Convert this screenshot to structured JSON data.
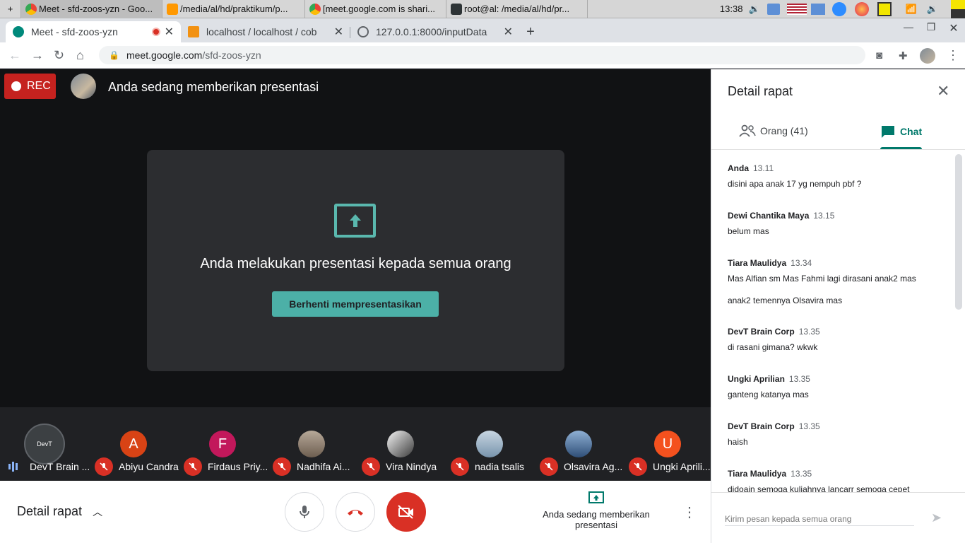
{
  "taskbar": {
    "items": [
      {
        "label": "+",
        "icon": "plus-icon"
      },
      {
        "label": "Meet - sfd-zoos-yzn - Goo...",
        "icon": "chrome-icon"
      },
      {
        "label": "/media/al/hd/praktikum/p...",
        "icon": "sublime-icon"
      },
      {
        "label": "[meet.google.com is shari...",
        "icon": "chrome-icon"
      },
      {
        "label": "root@al: /media/al/hd/pr...",
        "icon": "terminal-icon"
      }
    ],
    "clock": "13:38"
  },
  "browser": {
    "tabs": [
      {
        "title": "Meet - sfd-zoos-yzn",
        "active": true
      },
      {
        "title": "localhost / localhost / cob",
        "active": false
      },
      {
        "title": "127.0.0.1:8000/inputData",
        "active": false
      }
    ],
    "url_host": "meet.google.com",
    "url_path": "/sfd-zoos-yzn"
  },
  "meet": {
    "rec_label": "REC",
    "presenting_label": "Anda sedang memberikan presentasi",
    "card_text": "Anda melakukan presentasi kepada semua orang",
    "stop_button": "Berhenti mempresentasikan",
    "participants": [
      {
        "name": "DevT Brain ...",
        "initial": "",
        "color": "#3c4043"
      },
      {
        "name": "Abiyu Candra",
        "initial": "A",
        "color": "#d84315"
      },
      {
        "name": "Firdaus Priy...",
        "initial": "F",
        "color": "#c2185b"
      },
      {
        "name": "Nadhifa Ai...",
        "initial": "",
        "color": "#8d7b6a"
      },
      {
        "name": "Vira Nindya",
        "initial": "",
        "color": "#e8e8e8"
      },
      {
        "name": "nadia tsalis",
        "initial": "",
        "color": "#9fb6c9"
      },
      {
        "name": "Olsavira Ag...",
        "initial": "",
        "color": "#5e7fa8"
      },
      {
        "name": "Ungki Aprili...",
        "initial": "U",
        "color": "#f4511e"
      }
    ],
    "bottom": {
      "detail_label": "Detail rapat",
      "present_status": "Anda sedang memberikan presentasi"
    }
  },
  "panel": {
    "title": "Detail rapat",
    "tab_people": "Orang (41)",
    "tab_chat": "Chat",
    "messages": [
      {
        "sender": "Anda",
        "time": "13.11",
        "text": "disini apa anak 17 yg nempuh pbf ?"
      },
      {
        "sender": "Dewi Chantika Maya",
        "time": "13.15",
        "text": "belum mas"
      },
      {
        "sender": "Tiara Maulidya",
        "time": "13.34",
        "text": "Mas Alfian sm Mas Fahmi lagi dirasani anak2 mas",
        "text2": "anak2 temennya Olsavira mas"
      },
      {
        "sender": "DevT Brain Corp",
        "time": "13.35",
        "text": "di rasani gimana? wkwk"
      },
      {
        "sender": "Ungki Aprilian",
        "time": "13.35",
        "text": "ganteng katanya mas"
      },
      {
        "sender": "DevT Brain Corp",
        "time": "13.35",
        "text": "haish"
      },
      {
        "sender": "Tiara Maulidya",
        "time": "13.35",
        "text": "didoain semoga kuliahnya lancarr semoga cepet"
      }
    ],
    "input_placeholder": "Kirim pesan kepada semua orang"
  },
  "colors": {
    "accent": "#00796b",
    "rec": "#c5221f",
    "stop_button": "#4cb0a7",
    "end_call": "#d93025"
  }
}
